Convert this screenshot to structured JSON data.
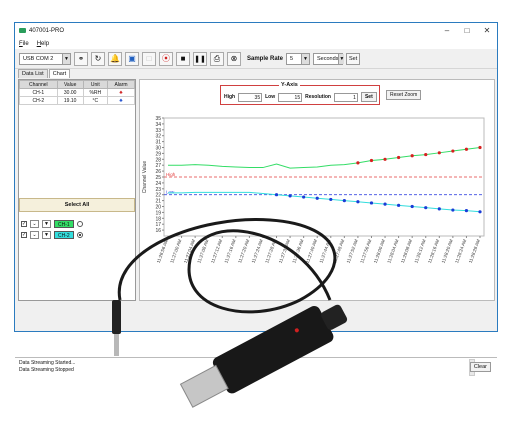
{
  "window": {
    "title": "407001-PRO"
  },
  "menu": [
    "File",
    "Help"
  ],
  "toolbar": {
    "port": "USB COM 2",
    "sample_rate_label": "Sample Rate",
    "sample_rate_value": "5",
    "sample_unit": "Seconds",
    "set_label": "Set"
  },
  "tabs": [
    "Data List",
    "Chart"
  ],
  "table": {
    "headers": [
      "Channel",
      "Value",
      "Unit",
      "Alarm"
    ],
    "rows": [
      {
        "channel": "CH-1",
        "value": "30.00",
        "unit": "%RH"
      },
      {
        "channel": "CH-2",
        "value": "19.10",
        "unit": "°C"
      }
    ]
  },
  "select_all_label": "Select All",
  "channels": [
    {
      "tag": "CH-1",
      "color": "#33dd66"
    },
    {
      "tag": "CH-2",
      "color": "#33dddd"
    }
  ],
  "y_axis_panel": {
    "caption": "Y-Axis",
    "high_label": "High",
    "high_value": "35",
    "low_label": "Low",
    "low_value": "15",
    "resolution_label": "Resolution",
    "resolution_value": "1",
    "set_label": "Set",
    "reset_zoom_label": "Reset Zoom"
  },
  "status": {
    "lines": [
      "Data Streaming Started...",
      "Data Streaming Stopped"
    ],
    "clear_label": "Clear"
  },
  "colors": {
    "titlebar_border": "#2b7bbf",
    "accent_green": "#2a9d5c",
    "limit_line": "#e23b3b",
    "low_line": "#3b4be2"
  },
  "chart_data": {
    "type": "line",
    "ylabel": "Channel Value",
    "ylim": [
      15,
      35
    ],
    "yticks": [
      16,
      17,
      18,
      19,
      20,
      21,
      22,
      23,
      24,
      25,
      26,
      27,
      28,
      29,
      30,
      31,
      32,
      33,
      34,
      35
    ],
    "x": [
      "11:26:56 AM",
      "11:27:00 AM",
      "11:27:04 AM",
      "11:27:08 AM",
      "11:27:12 AM",
      "11:27:16 AM",
      "11:27:20 AM",
      "11:27:24 AM",
      "11:27:28 AM",
      "11:27:32 AM",
      "11:27:36 AM",
      "11:27:40 AM",
      "11:27:44 AM",
      "11:27:48 AM",
      "11:27:52 AM",
      "11:27:56 AM",
      "11:28:00 AM",
      "11:28:04 AM",
      "11:28:08 AM",
      "11:28:12 AM",
      "11:28:16 AM",
      "11:28:20 AM",
      "11:28:24 AM",
      "11:28:28 AM"
    ],
    "limits": [
      {
        "name": "High",
        "value": 25,
        "color": "#e23b3b"
      },
      {
        "name": "Low",
        "value": 22,
        "color": "#3b4be2"
      }
    ],
    "series": [
      {
        "color": "#33dd66",
        "alarm_color": "#d62020",
        "values": [
          27,
          27,
          27.1,
          27,
          26.8,
          26.7,
          26.6,
          26.6,
          27.2,
          26.5,
          26.6,
          26.7,
          27,
          27.1,
          27.4,
          27.8,
          28,
          28.3,
          28.6,
          28.8,
          29.1,
          29.4,
          29.7,
          30
        ],
        "alarm_from": 14
      },
      {
        "color": "#33dddd",
        "alarm_color": "#1a3bd6",
        "values": [
          22.3,
          22.3,
          22.4,
          22.4,
          22.4,
          22.4,
          22.4,
          22.2,
          22,
          21.8,
          21.6,
          21.4,
          21.2,
          21,
          20.8,
          20.6,
          20.4,
          20.2,
          20,
          19.8,
          19.6,
          19.4,
          19.3,
          19.1
        ],
        "alarm_from": 8
      }
    ]
  }
}
